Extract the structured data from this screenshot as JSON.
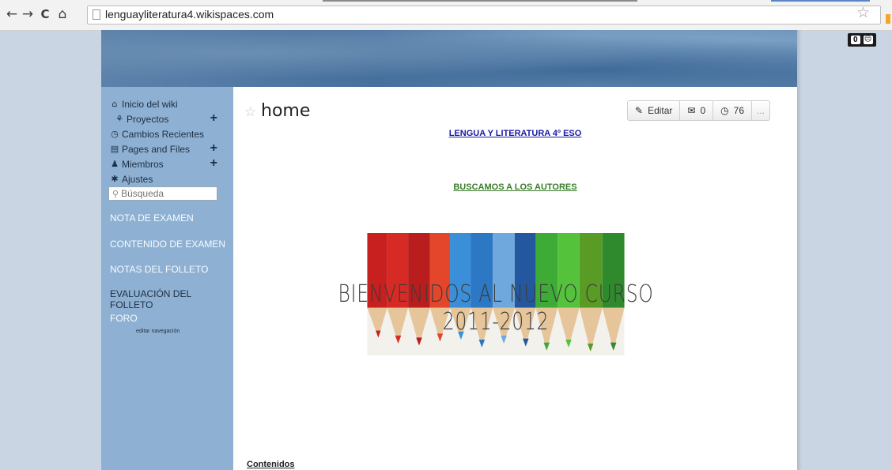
{
  "browser": {
    "url": "lenguayliteratura4.wikispaces.com",
    "back_icon": "←",
    "forward_icon": "→",
    "reload_icon": "C",
    "home_icon": "⌂",
    "star_icon": "☆",
    "extension_count": "0"
  },
  "sidebar": {
    "items": [
      {
        "label": "Inicio del wiki",
        "icon": "⌂"
      },
      {
        "label": "Proyectos",
        "icon": "⚘",
        "plus": "+"
      },
      {
        "label": "Cambios Recientes",
        "icon": "◷"
      },
      {
        "label": "Pages and Files",
        "icon": "▤",
        "plus": "+"
      },
      {
        "label": "Miembros",
        "icon": "♟",
        "plus": "+"
      },
      {
        "label": "Ajustes",
        "icon": "✱"
      }
    ],
    "search_placeholder": "Búsqueda",
    "links": [
      "NOTA DE EXAMEN",
      "CONTENIDO DE EXAMEN",
      "NOTAS DEL FOLLETO",
      "EVALUACIÓN DEL FOLLETO",
      "FORO"
    ],
    "edit_nav": "editar navegación"
  },
  "main": {
    "title": "home",
    "actions": {
      "edit_label": "Editar",
      "comments_count": "0",
      "history_count": "76",
      "more_label": "..."
    },
    "heading1": "LENGUA Y LITERATURA 4º ESO",
    "heading2": "BUSCAMOS A LOS AUTORES",
    "banner_text": "BIENVENIDOS AL NUEVO CURSO 2011-2012",
    "contents_label": "Contenidos"
  },
  "colors": {
    "sidebar_bg": "#8eb0d2",
    "page_bg": "#c9d5e2",
    "link_blue": "#1a1aa6",
    "link_green": "#3a7d2a"
  }
}
